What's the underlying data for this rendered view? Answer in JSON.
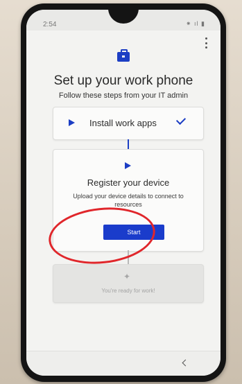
{
  "status": {
    "time": "2:54",
    "icons": "⁕ ıl ▮"
  },
  "header": {
    "title": "Set up your work phone",
    "subtitle": "Follow these steps from your IT admin"
  },
  "steps": [
    {
      "label": "Install work apps",
      "state": "done"
    },
    {
      "label": "Register your device",
      "description": "Upload your device details to connect to resources",
      "button": "Start",
      "state": "active"
    },
    {
      "label": "You're ready for work!",
      "state": "pending"
    }
  ],
  "colors": {
    "accent": "#1c3ec4",
    "annotation": "#e0262b"
  }
}
